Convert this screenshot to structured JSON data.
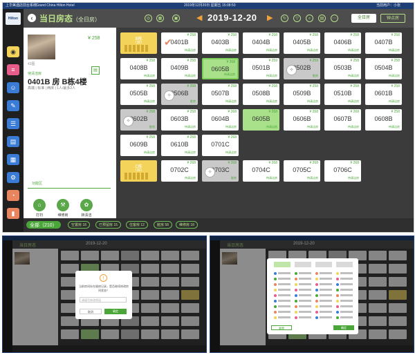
{
  "topbar": {
    "left": "上华美酒店前台系统",
    "hotel": "Grand China Hilton Hotel",
    "datetime": "2019年12月20日 星期五 15:08:50",
    "user": "当前用户：小张"
  },
  "header": {
    "title": "当日房态",
    "subtitle": "（全日房）",
    "date": "2019-12-20",
    "btn_all_day": "全日房",
    "btn_hourly": "钟点房",
    "accent": "#b8e08a"
  },
  "room_detail": {
    "photo_label": "43图",
    "price": "¥ 258",
    "status": "待清洁房",
    "name": "0401B 房 B栋4楼",
    "sub": "高端 | 标准 | 两床 | 1人/最多2人",
    "tab": "功能区",
    "actions": [
      "打扫",
      "维修房",
      "转清洁"
    ]
  },
  "rooms": [
    {
      "no": "0401B",
      "price": "¥ 258",
      "status": "待清洁房",
      "style": "checked"
    },
    {
      "no": "0403B",
      "price": "¥ 258",
      "status": "待清洁房",
      "style": "white"
    },
    {
      "no": "0404B",
      "price": "¥ 258",
      "status": "待清洁房",
      "style": "white"
    },
    {
      "no": "0405B",
      "price": "¥ 258",
      "status": "待清洁房",
      "style": "white"
    },
    {
      "no": "0406B",
      "price": "¥ 258",
      "status": "待清洁房",
      "style": "white"
    },
    {
      "no": "0407B",
      "price": "¥ 258",
      "status": "待清洁房",
      "style": "white"
    },
    {
      "no": "0408B",
      "price": "¥ 258",
      "status": "待清洁房",
      "style": "white"
    },
    {
      "no": "0409B",
      "price": "¥ 258",
      "status": "待清洁房",
      "style": "white"
    },
    {
      "no": "0605B",
      "price": "¥ 268",
      "status": "待清洁房",
      "style": "selected"
    },
    {
      "no": "0501B",
      "price": "¥ 259",
      "status": "待清洁房",
      "style": "white"
    },
    {
      "no": "0502B",
      "price": "¥ 259",
      "status": "脏房",
      "style": "gray"
    },
    {
      "no": "0503B",
      "price": "¥ 258",
      "status": "待清洁房",
      "style": "white"
    },
    {
      "no": "0504B",
      "price": "¥ 258",
      "status": "待清洁房",
      "style": "white"
    },
    {
      "no": "0505B",
      "price": "¥ 258",
      "status": "待清洁房",
      "style": "white"
    },
    {
      "no": "0506B",
      "price": "¥ 258",
      "status": "脏房",
      "style": "gray"
    },
    {
      "no": "0507B",
      "price": "¥ 258",
      "status": "待清洁房",
      "style": "white"
    },
    {
      "no": "0508B",
      "price": "¥ 258",
      "status": "待清洁房",
      "style": "white"
    },
    {
      "no": "0509B",
      "price": "¥ 258",
      "status": "待清洁房",
      "style": "white"
    },
    {
      "no": "0510B",
      "price": "¥ 258",
      "status": "待清洁房",
      "style": "white"
    },
    {
      "no": "0601B",
      "price": "¥ 258",
      "status": "待清洁房",
      "style": "white"
    },
    {
      "no": "0602B",
      "price": "¥ 258",
      "status": "脏房",
      "style": "gray"
    },
    {
      "no": "0603B",
      "price": "¥ 258",
      "status": "待清洁房",
      "style": "white"
    },
    {
      "no": "0604B",
      "price": "¥ 268",
      "status": "待清洁房",
      "style": "white"
    },
    {
      "no": "0605B",
      "price": "¥ 268",
      "status": "待清洁房",
      "style": "green"
    },
    {
      "no": "0606B",
      "price": "¥ 268",
      "status": "待清洁房",
      "style": "white"
    },
    {
      "no": "0607B",
      "price": "¥ 268",
      "status": "待清洁房",
      "style": "white"
    },
    {
      "no": "0608B",
      "price": "¥ 258",
      "status": "待清洁房",
      "style": "white"
    },
    {
      "no": "0609B",
      "price": "¥ 258",
      "status": "待清洁房",
      "style": "white"
    },
    {
      "no": "0610B",
      "price": "¥ 258",
      "status": "待清洁房",
      "style": "white"
    },
    {
      "no": "0701C",
      "price": "¥ 268",
      "status": "待清洁房",
      "style": "white"
    },
    {
      "no": "0702C",
      "price": "¥ 268",
      "status": "待清洁房",
      "style": "white"
    },
    {
      "no": "0703C",
      "price": "¥ 268",
      "status": "脏房",
      "style": "gray"
    },
    {
      "no": "0704C",
      "price": "¥ 268",
      "status": "待清洁房",
      "style": "white"
    },
    {
      "no": "0705C",
      "price": "¥ 268",
      "status": "待清洁房",
      "style": "white"
    },
    {
      "no": "0706C",
      "price": "¥ 268",
      "status": "待清洁房",
      "style": "white"
    }
  ],
  "buildings": [
    {
      "name": "B栋",
      "count": "（30）"
    },
    {
      "name": "C栋",
      "count": "（30）"
    }
  ],
  "footer": {
    "total": "全部（210）",
    "chips": [
      "空置房 18",
      "已预留房 15",
      "住客房 12",
      "脏房 58",
      "维修房 18"
    ]
  },
  "thumb_left": {
    "title": "当日房态",
    "date": "2019-12-20",
    "dialog_msg": "当前房间存在维修记录，是否继续修改房间状态？",
    "dialog_input": "请填写修改原因",
    "btn_cancel": "取消",
    "btn_confirm": "确定"
  },
  "thumb_right": {
    "title": "当日房态",
    "date": "2019-12-20",
    "btn_reset": "重置",
    "btn_submit": "确定"
  }
}
